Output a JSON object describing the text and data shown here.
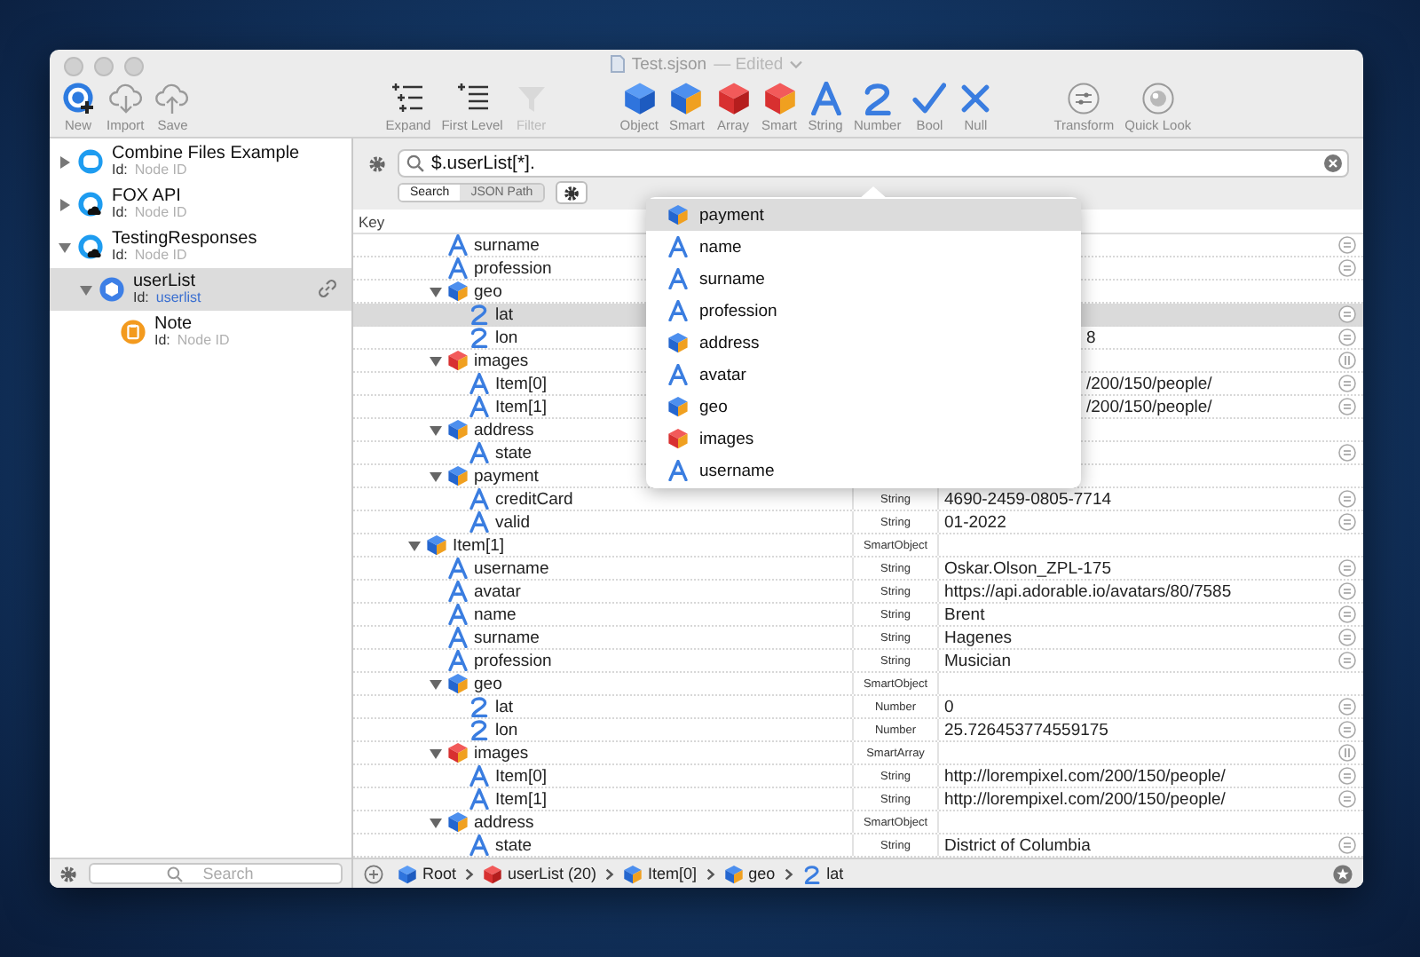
{
  "window": {
    "title": "Test.sjson",
    "subtitle": "— Edited"
  },
  "toolbar": [
    [
      {
        "kind": "new",
        "label": "New",
        "disabled": false
      },
      {
        "kind": "import",
        "label": "Import",
        "disabled": false
      },
      {
        "kind": "save",
        "label": "Save",
        "disabled": false
      }
    ],
    [
      {
        "kind": "expand",
        "label": "Expand",
        "disabled": false
      },
      {
        "kind": "first-level",
        "label": "First Level",
        "disabled": false
      },
      {
        "kind": "filter",
        "label": "Filter",
        "disabled": true
      }
    ],
    [
      {
        "kind": "object",
        "label": "Object",
        "disabled": false
      },
      {
        "kind": "smart-object",
        "label": "Smart",
        "disabled": false
      },
      {
        "kind": "array",
        "label": "Array",
        "disabled": false
      },
      {
        "kind": "smart-array",
        "label": "Smart",
        "disabled": false
      },
      {
        "kind": "string",
        "label": "String",
        "disabled": false
      },
      {
        "kind": "number",
        "label": "Number",
        "disabled": false
      },
      {
        "kind": "bool",
        "label": "Bool",
        "disabled": false
      },
      {
        "kind": "null",
        "label": "Null",
        "disabled": false
      }
    ],
    [
      {
        "kind": "transform",
        "label": "Transform",
        "disabled": false
      },
      {
        "kind": "quick-look",
        "label": "Quick Look",
        "disabled": false
      }
    ]
  ],
  "sidebar": {
    "items": [
      {
        "kind": "bubble",
        "title": "Combine Files Example",
        "id_label": "Id:",
        "id_placeholder": "Node ID",
        "expanded": false,
        "selected": false
      },
      {
        "kind": "cloud",
        "title": "FOX API",
        "id_label": "Id:",
        "id_placeholder": "Node ID",
        "expanded": false,
        "selected": false
      },
      {
        "kind": "cloud",
        "title": "TestingResponses",
        "id_label": "Id:",
        "id_placeholder": "Node ID",
        "expanded": true,
        "selected": false,
        "children": [
          {
            "kind": "object",
            "title": "userList",
            "id_label": "Id:",
            "id": "userlist",
            "expanded": true,
            "selected": true,
            "linked": true,
            "children": [
              {
                "kind": "note",
                "title": "Note",
                "id_label": "Id:",
                "id_placeholder": "Node ID",
                "selected": false
              }
            ]
          }
        ]
      }
    ],
    "search": {
      "placeholder": "Search"
    }
  },
  "query": {
    "value": "$.userList[*].",
    "modes": [
      {
        "label": "Search",
        "selected": true
      },
      {
        "label": "JSON Path",
        "selected": false
      }
    ]
  },
  "table": {
    "columns": [
      "Key"
    ],
    "rows": [
      {
        "children": [
          {
            "kind": "string",
            "key": "surname",
            "selected": false
          },
          {
            "kind": "string",
            "key": "profession",
            "selected": false
          },
          {
            "kind": "smart-object",
            "key": "geo",
            "expanded": true,
            "selected": false,
            "children": [
              {
                "kind": "number",
                "key": "lat",
                "selected": true
              },
              {
                "kind": "number",
                "key": "lon",
                "value_visible": "8",
                "selected": false
              }
            ]
          },
          {
            "kind": "smart-array",
            "key": "images",
            "expanded": true,
            "selected": false,
            "children": [
              {
                "kind": "string",
                "key": "Item[0]",
                "value_visible": "/200/150/people/",
                "selected": false
              },
              {
                "kind": "string",
                "key": "Item[1]",
                "value_visible": "/200/150/people/",
                "selected": false
              }
            ]
          },
          {
            "kind": "smart-object",
            "key": "address",
            "expanded": true,
            "selected": false,
            "children": [
              {
                "kind": "string",
                "key": "state",
                "selected": false
              }
            ]
          },
          {
            "kind": "smart-object",
            "key": "payment",
            "expanded": true,
            "selected": false,
            "children": [
              {
                "kind": "string",
                "key": "creditCard",
                "type": "String",
                "value": "4690-2459-0805-7714",
                "selected": false
              },
              {
                "kind": "string",
                "key": "valid",
                "type": "String",
                "value": "01-2022",
                "selected": false
              }
            ]
          }
        ]
      },
      {
        "kind": "smart-object",
        "key": "Item[1]",
        "type": "SmartObject",
        "expanded": true,
        "selected": false,
        "children": [
          {
            "kind": "string",
            "key": "username",
            "type": "String",
            "value": "Oskar.Olson_ZPL-175",
            "selected": false
          },
          {
            "kind": "string",
            "key": "avatar",
            "type": "String",
            "value": "https://api.adorable.io/avatars/80/7585",
            "selected": false
          },
          {
            "kind": "string",
            "key": "name",
            "type": "String",
            "value": "Brent",
            "selected": false
          },
          {
            "kind": "string",
            "key": "surname",
            "type": "String",
            "value": "Hagenes",
            "selected": false
          },
          {
            "kind": "string",
            "key": "profession",
            "type": "String",
            "value": "Musician",
            "selected": false
          },
          {
            "kind": "smart-object",
            "key": "geo",
            "type": "SmartObject",
            "expanded": true,
            "selected": false,
            "children": [
              {
                "kind": "number",
                "key": "lat",
                "type": "Number",
                "value": "0",
                "selected": false
              },
              {
                "kind": "number",
                "key": "lon",
                "type": "Number",
                "value": "25.726453774559175",
                "selected": false
              }
            ]
          },
          {
            "kind": "smart-array",
            "key": "images",
            "type": "SmartArray",
            "expanded": true,
            "selected": false,
            "children": [
              {
                "kind": "string",
                "key": "Item[0]",
                "type": "String",
                "value": "http://lorempixel.com/200/150/people/",
                "selected": false
              },
              {
                "kind": "string",
                "key": "Item[1]",
                "type": "String",
                "value": "http://lorempixel.com/200/150/people/",
                "selected": false
              }
            ]
          },
          {
            "kind": "smart-object",
            "key": "address",
            "type": "SmartObject",
            "expanded": true,
            "selected": false,
            "children": [
              {
                "kind": "string",
                "key": "state",
                "type": "String",
                "value": "District of Columbia",
                "selected": false
              }
            ]
          }
        ]
      }
    ]
  },
  "completions": [
    {
      "kind": "smart-object",
      "label": "payment",
      "selected": true
    },
    {
      "kind": "string",
      "label": "name",
      "selected": false
    },
    {
      "kind": "string",
      "label": "surname",
      "selected": false
    },
    {
      "kind": "string",
      "label": "profession",
      "selected": false
    },
    {
      "kind": "smart-object",
      "label": "address",
      "selected": false
    },
    {
      "kind": "string",
      "label": "avatar",
      "selected": false
    },
    {
      "kind": "smart-object",
      "label": "geo",
      "selected": false
    },
    {
      "kind": "smart-array",
      "label": "images",
      "selected": false
    },
    {
      "kind": "string",
      "label": "username",
      "selected": false
    }
  ],
  "breadcrumb": [
    {
      "kind": "object",
      "label": "Root"
    },
    {
      "kind": "array",
      "label": "userList (20)"
    },
    {
      "kind": "smart-object",
      "label": "Item[0]"
    },
    {
      "kind": "smart-object",
      "label": "geo"
    },
    {
      "kind": "number",
      "label": "lat"
    }
  ]
}
